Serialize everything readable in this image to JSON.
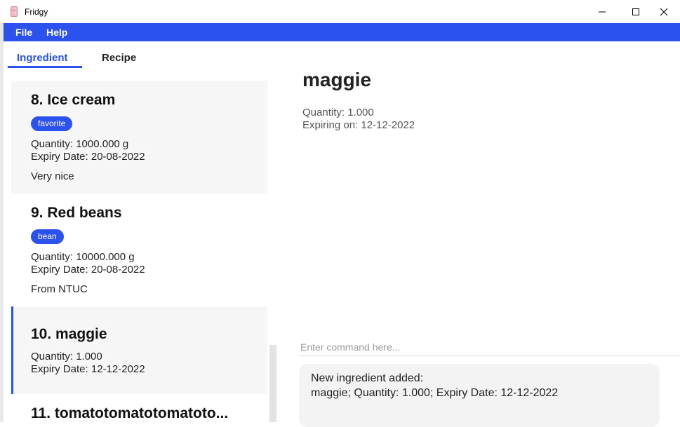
{
  "window": {
    "title": "Fridgy"
  },
  "menu": {
    "file": "File",
    "help": "Help"
  },
  "tabs": [
    {
      "label": "Ingredient",
      "active": true
    },
    {
      "label": "Recipe",
      "active": false
    }
  ],
  "ingredients": [
    {
      "title": "8.  Ice cream",
      "tag": "favorite",
      "quantity": "Quantity: 1000.000 g",
      "expiry": "Expiry Date: 20-08-2022",
      "note": "Very nice"
    },
    {
      "title": "9.  Red beans",
      "tag": "bean",
      "quantity": "Quantity: 10000.000 g",
      "expiry": "Expiry Date: 20-08-2022",
      "note": "From NTUC"
    },
    {
      "title": "10.  maggie",
      "quantity": "Quantity: 1.000",
      "expiry": "Expiry Date: 12-12-2022"
    },
    {
      "title": "11.  tomatotomatotomatoto..."
    }
  ],
  "detail": {
    "name": "maggie",
    "quantity": "Quantity: 1.000",
    "expiring": "Expiring on: 12-12-2022"
  },
  "command": {
    "placeholder": "Enter command here...",
    "value": ""
  },
  "result": {
    "line1": "New ingredient added:",
    "line2": "maggie; Quantity: 1.000; Expiry Date: 12-12-2022"
  },
  "colors": {
    "accent": "#2b52ee",
    "card_bg": "#f6f6f6"
  }
}
